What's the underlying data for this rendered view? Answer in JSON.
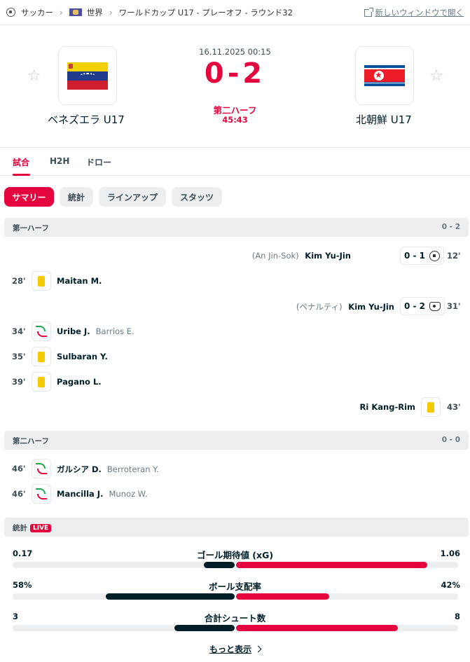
{
  "breadcrumb": {
    "sport": "サッカー",
    "country": "世界",
    "competition": "ワールドカップ U17 - プレーオフ - ラウンド32"
  },
  "new_window": "新しいウィンドウで開く",
  "match": {
    "date": "16.11.2025 00:15",
    "score": "0-2",
    "phase": "第二ハーフ",
    "clock": "45:43",
    "home": {
      "name": "ベネズエラ U17",
      "flag": "venezuela-flag"
    },
    "away": {
      "name": "北朝鮮 U17",
      "flag": "north-korea-flag"
    }
  },
  "tabs": [
    "試合",
    "H2H",
    "ドロー"
  ],
  "subtabs": [
    "サマリー",
    "統計",
    "ラインアップ",
    "スタッツ"
  ],
  "first_half": {
    "label": "第一ハーフ",
    "score": "0 - 2",
    "incidents": [
      {
        "minute": "12'",
        "assist": "(An Jin-Sok)",
        "player": "Kim Yu-Jin",
        "score": "0 - 1",
        "icon": "soccer-ball-icon"
      },
      {
        "minute": "28'",
        "player": "Maitan M.",
        "icon": "yellow-card-icon"
      },
      {
        "minute": "31'",
        "assist": "(ペナルティ)",
        "player": "Kim Yu-Jin",
        "score": "0 - 2",
        "icon": "penalty-icon"
      },
      {
        "minute": "34'",
        "player": "Uribe J.",
        "player_out": "Barrios E.",
        "icon": "substitution-icon"
      },
      {
        "minute": "35'",
        "player": "Sulbaran Y.",
        "icon": "yellow-card-icon"
      },
      {
        "minute": "39'",
        "player": "Pagano L.",
        "icon": "yellow-card-icon"
      },
      {
        "minute": "43'",
        "player": "Ri Kang-Rim",
        "icon": "yellow-card-icon"
      }
    ]
  },
  "second_half": {
    "label": "第二ハーフ",
    "score": "0 - 0",
    "incidents": [
      {
        "minute": "46'",
        "player": "ガルシア D.",
        "player_out": "Berroteran Y.",
        "icon": "substitution-icon"
      },
      {
        "minute": "46'",
        "player": "Mancilla J.",
        "player_out": "Munoz W.",
        "icon": "substitution-icon"
      }
    ]
  },
  "stats_section": {
    "label": "統計",
    "live": "LIVE"
  },
  "stats": [
    {
      "label": "ゴール期待値 (xG)",
      "home": "0.17",
      "away": "1.06",
      "home_fraction": 0.14,
      "away_fraction": 0.86
    },
    {
      "label": "ボール支配率",
      "home": "58%",
      "away": "42%",
      "home_fraction": 0.58,
      "away_fraction": 0.42
    },
    {
      "label": "合計シュート数",
      "home": "3",
      "away": "8",
      "home_fraction": 0.27,
      "away_fraction": 0.73
    }
  ],
  "more": "もっと表示",
  "colors": {
    "accent": "#e4053f",
    "dark": "#001e28",
    "yellow_card": "#f5c900",
    "sub_in": "#1fa84e"
  }
}
